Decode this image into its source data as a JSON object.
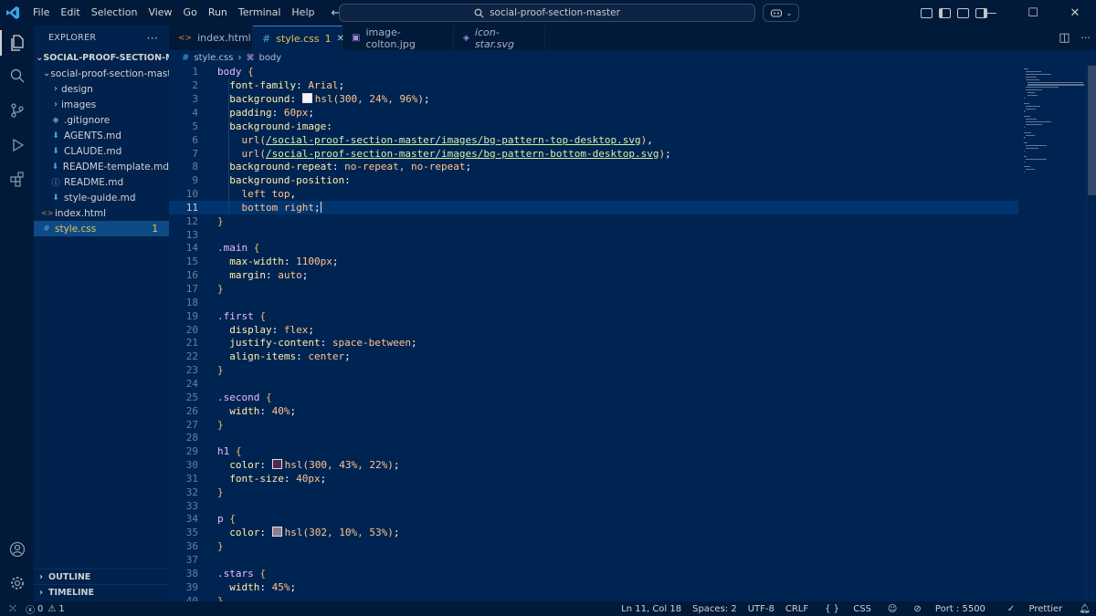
{
  "titlebar": {
    "menu": [
      "File",
      "Edit",
      "Selection",
      "View",
      "Go",
      "Run",
      "Terminal",
      "Help"
    ],
    "search_text": "social-proof-section-master"
  },
  "sidebar": {
    "header": "EXPLORER",
    "folder": "SOCIAL-PROOF-SECTION-MA...",
    "subfolder": "social-proof-section-mast...",
    "items": [
      {
        "label": "design",
        "type": "folder"
      },
      {
        "label": "images",
        "type": "folder"
      },
      {
        "label": ".gitignore",
        "type": "file"
      },
      {
        "label": "AGENTS.md",
        "type": "md"
      },
      {
        "label": "CLAUDE.md",
        "type": "md"
      },
      {
        "label": "README-template.md",
        "type": "md"
      },
      {
        "label": "README.md",
        "type": "info"
      },
      {
        "label": "style-guide.md",
        "type": "md"
      }
    ],
    "root_files": [
      {
        "label": "index.html",
        "type": "html"
      },
      {
        "label": "style.css",
        "type": "css",
        "badge": "1"
      }
    ],
    "outline": "OUTLINE",
    "timeline": "TIMELINE"
  },
  "tabs": [
    {
      "label": "index.html",
      "icon": "html-icon"
    },
    {
      "label": "style.css",
      "icon": "css-icon",
      "badge": "1",
      "active": true
    },
    {
      "label": "image-colton.jpg",
      "icon": "image-icon"
    },
    {
      "label": "icon-star.svg",
      "icon": "svg-icon"
    }
  ],
  "breadcrumb": {
    "file": "style.css",
    "symbol": "body"
  },
  "editor": {
    "current_line": 11,
    "lines": [
      "body {",
      "  font-family: Arial;",
      "  background: hsl(300, 24%, 96%);",
      "  padding: 60px;",
      "  background-image:",
      "    url(/social-proof-section-master/images/bg-pattern-top-desktop.svg),",
      "    url(/social-proof-section-master/images/bg-pattern-bottom-desktop.svg);",
      "  background-repeat: no-repeat, no-repeat;",
      "  background-position:",
      "    left top,",
      "    bottom right;",
      "}",
      "",
      ".main {",
      "  max-width: 1100px;",
      "  margin: auto;",
      "}",
      "",
      ".first {",
      "  display: flex;",
      "  justify-content: space-between;",
      "  align-items: center;",
      "}",
      "",
      ".second {",
      "  width: 40%;",
      "}",
      "",
      "h1 {",
      "  color: hsl(300, 43%, 22%);",
      "  font-size: 40px;",
      "}",
      "",
      "p {",
      "  color: hsl(302, 10%, 53%);",
      "}",
      "",
      ".stars {",
      "  width: 45%;",
      "}",
      ""
    ],
    "swatches": {
      "3": "#f7f2f7",
      "30": "#532653",
      "35": "#8e7d8e"
    }
  },
  "statusbar": {
    "errors": "0",
    "warnings": "1",
    "position": "Ln 11, Col 18",
    "spaces": "Spaces: 2",
    "encoding": "UTF-8",
    "eol": "CRLF",
    "language": "CSS",
    "port": "Port : 5500",
    "formatter": "Prettier"
  },
  "colors": {
    "accent": "#e6c05b",
    "background": "#002451",
    "selection": "#0e4a84"
  }
}
